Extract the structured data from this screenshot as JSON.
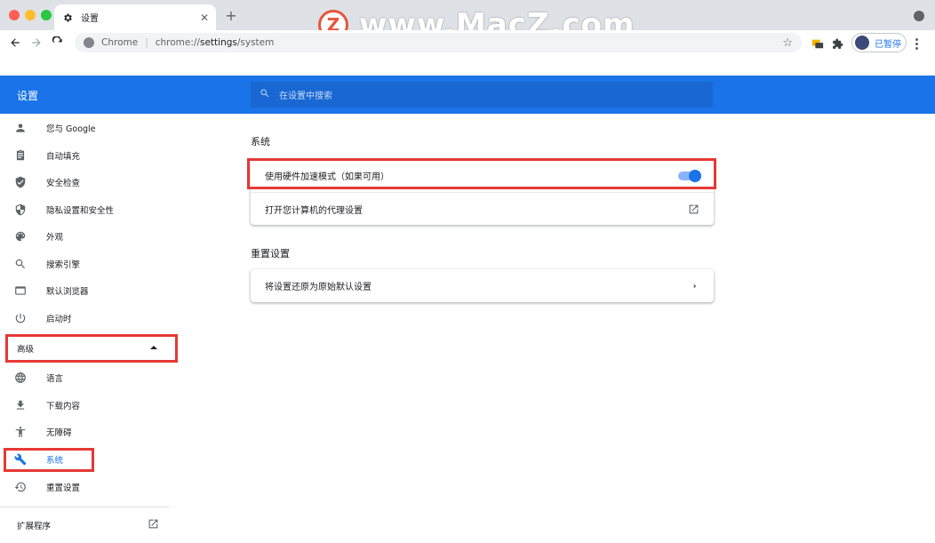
{
  "window": {
    "traffic_lights": [
      "#ff5f57",
      "#febc2e",
      "#28c840"
    ]
  },
  "tab": {
    "title": "设置",
    "icon": "gear-icon",
    "close_icon": "close-icon"
  },
  "new_tab_label": "+",
  "watermark": {
    "logo_letter": "Z",
    "text": "www.MacZ.com"
  },
  "toolbar": {
    "back_icon": "back-arrow-icon",
    "forward_icon": "forward-arrow-icon",
    "reload_icon": "reload-icon",
    "site_label": "Chrome",
    "url_prefix": "chrome://",
    "url_bold": "settings",
    "url_suffix": "/system",
    "bookmark_icon": "star-icon",
    "profile_label": "已暂停"
  },
  "header": {
    "title": "设置",
    "search_placeholder": "在设置中搜索"
  },
  "sidebar": {
    "items": [
      {
        "label": "您与 Google",
        "icon": "person-icon"
      },
      {
        "label": "自动填充",
        "icon": "clipboard-icon"
      },
      {
        "label": "安全检查",
        "icon": "shield-check-icon"
      },
      {
        "label": "隐私设置和安全性",
        "icon": "shield-half-icon"
      },
      {
        "label": "外观",
        "icon": "palette-icon"
      },
      {
        "label": "搜索引擎",
        "icon": "search-icon"
      },
      {
        "label": "默认浏览器",
        "icon": "browser-window-icon"
      },
      {
        "label": "启动时",
        "icon": "power-icon"
      }
    ],
    "advanced_label": "高级",
    "advanced_items": [
      {
        "label": "语言",
        "icon": "globe-icon"
      },
      {
        "label": "下载内容",
        "icon": "download-icon"
      },
      {
        "label": "无障碍",
        "icon": "accessibility-icon"
      },
      {
        "label": "系统",
        "icon": "wrench-icon"
      },
      {
        "label": "重置设置",
        "icon": "restore-icon"
      }
    ],
    "extensions_label": "扩展程序"
  },
  "main": {
    "system_title": "系统",
    "hardware_accel_label": "使用硬件加速模式（如果可用）",
    "hardware_accel_enabled": true,
    "proxy_label": "打开您计算机的代理设置",
    "reset_title": "重置设置",
    "reset_label": "将设置还原为原始默认设置"
  },
  "colors": {
    "accent": "#1a73e8",
    "highlight": "#e53935"
  }
}
